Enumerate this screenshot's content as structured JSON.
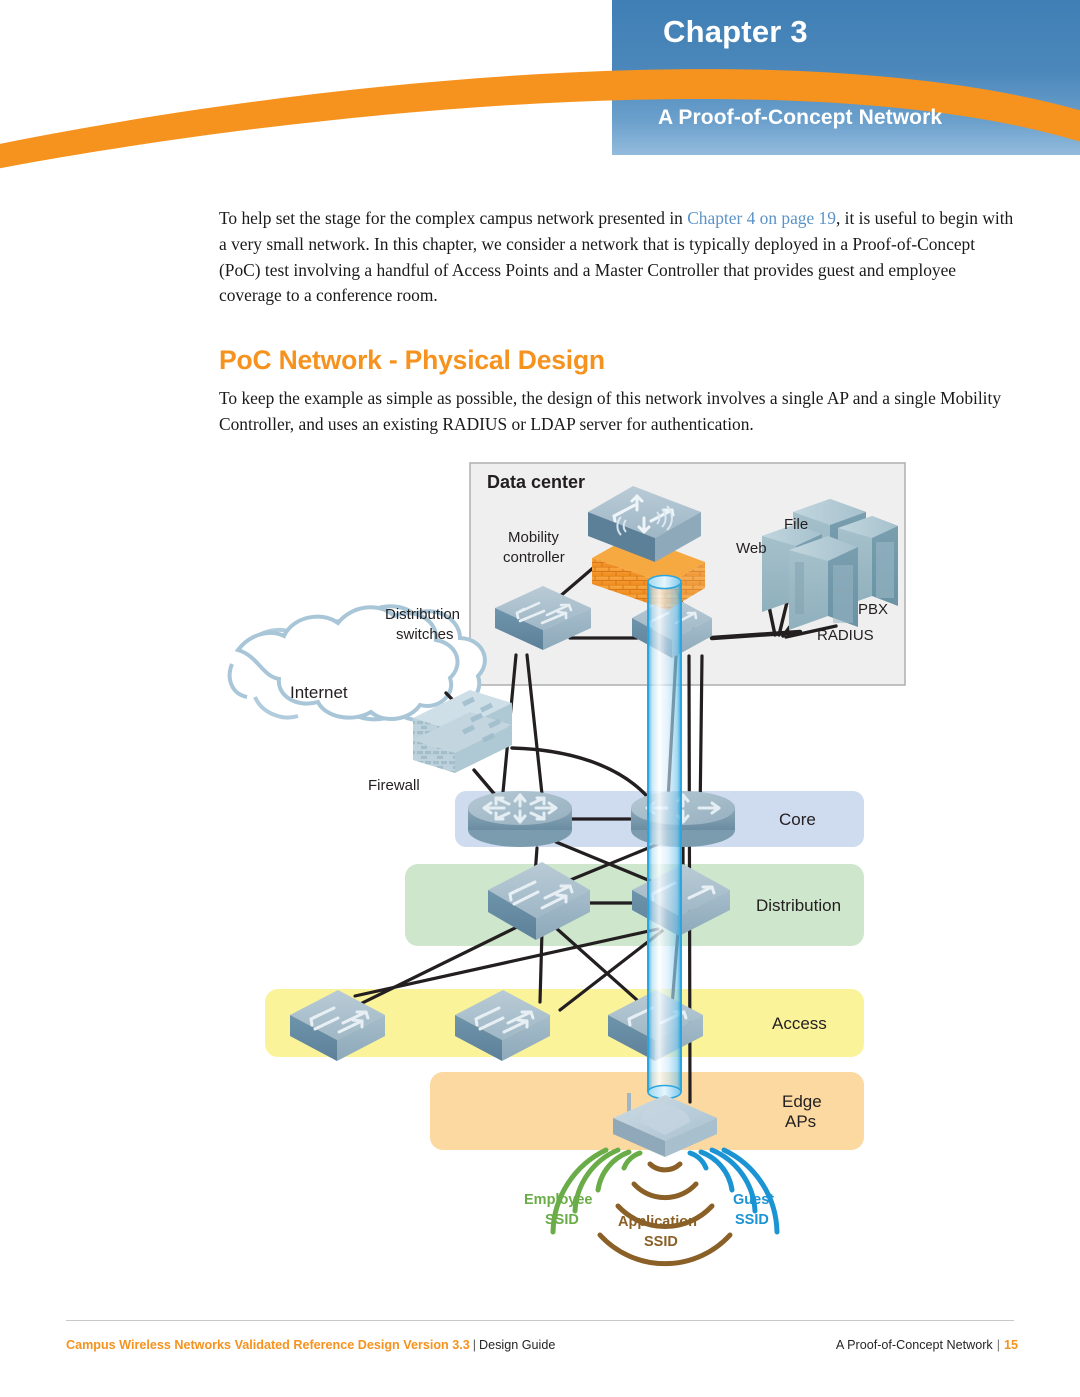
{
  "header": {
    "chapter_label": "Chapter",
    "chapter_number": "3",
    "chapter_title": "A Proof-of-Concept Network",
    "panel_color": "#4b87ba",
    "swoosh_color": "#f6921e"
  },
  "intro": {
    "part1": "To help set the stage for the complex campus network presented in ",
    "link": "Chapter 4 on page 19",
    "part2": ", it is useful to begin with a very small network. In this chapter, we consider a network that is typically deployed in a Proof-of-Concept (PoC) test involving a handful of Access Points and a Master Controller that provides guest and employee coverage to a conference room."
  },
  "section": {
    "heading": "PoC Network - Physical Design",
    "heading_color": "#f6921e",
    "paragraph": "To keep the example as simple as possible, the design of this network involves a single AP and a single Mobility Controller, and uses an existing RADIUS or LDAP server for authentication."
  },
  "diagram": {
    "datacenter_title": "Data center",
    "labels": {
      "mobility_controller": "Mobility\ncontroller",
      "mobility_controller_line1": "Mobility",
      "mobility_controller_line2": "controller",
      "distribution_switches_line1": "Distribution",
      "distribution_switches_line2": "switches",
      "internet": "Internet",
      "firewall": "Firewall",
      "web": "Web",
      "file": "File",
      "pbx": "PBX",
      "radius": "RADIUS"
    },
    "tiers": [
      {
        "name": "Core",
        "color": "#cfdcf0"
      },
      {
        "name": "Distribution",
        "color": "#cee6cb"
      },
      {
        "name": "Access",
        "color": "#fbf39a"
      },
      {
        "name": "Edge\nAPs",
        "line1": "Edge",
        "line2": "APs",
        "color": "#fbd9a0"
      }
    ],
    "ssids": [
      {
        "label_line1": "Employee",
        "label_line2": "SSID",
        "color": "#6aad48"
      },
      {
        "label_line1": "Application",
        "label_line2": "SSID",
        "color": "#8a6027"
      },
      {
        "label_line1": "Guest",
        "label_line2": "SSID",
        "color": "#1b94d4"
      }
    ]
  },
  "footer": {
    "doc_title": "Campus Wireless Networks Validated Reference Design Version 3.3",
    "separator": "|",
    "doc_type": "Design Guide",
    "chapter_title": "A Proof-of-Concept Network",
    "page_number": "15"
  }
}
